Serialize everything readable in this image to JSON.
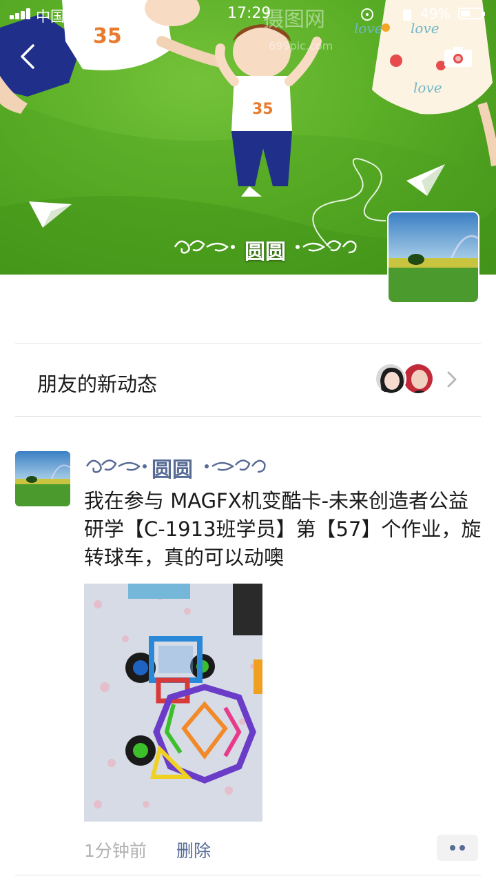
{
  "status_bar": {
    "carrier": "中国",
    "time": "17:29",
    "battery_percent": "49%"
  },
  "cover": {
    "watermark_text": "摄图网",
    "watermark_sub": "699pic.com",
    "shirt_number": "35",
    "dress_text": "love",
    "username": "圆圆"
  },
  "friends_updates": {
    "label": "朋友的新动态"
  },
  "post": {
    "username": "圆圆",
    "text": "我在参与 MAGFX机变酷卡-未来创造者公益研学【C-1913班学员】第【57】个作业，旋转球车，真的可以动噢",
    "time": "1分钟前",
    "delete_label": "删除"
  },
  "colors": {
    "link_blue": "#576b95",
    "cover_green": "#5aae26",
    "muted_gray": "#b2b2b2"
  },
  "icons": [
    "back-arrow-icon",
    "camera-icon",
    "chevron-right-icon",
    "more-dots-icon",
    "signal-icon",
    "wifi-icon",
    "battery-icon"
  ]
}
